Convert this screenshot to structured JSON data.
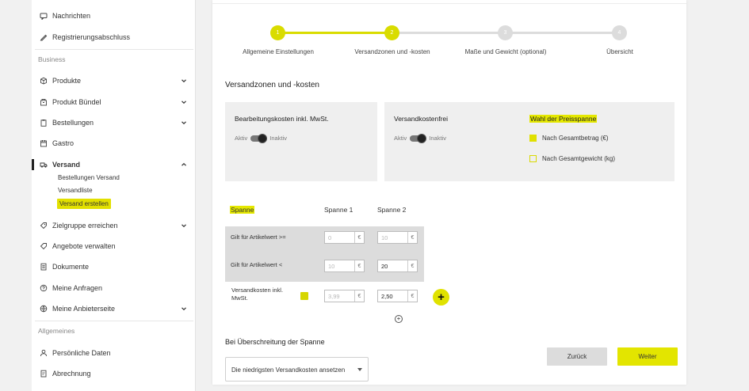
{
  "sidebar": {
    "items_top": [
      {
        "icon": "message-icon",
        "label": "Nachrichten"
      },
      {
        "icon": "pen-icon",
        "label": "Registrierungsabschluss"
      }
    ],
    "section_business": "Business",
    "items_business": [
      {
        "icon": "box-icon",
        "label": "Produkte"
      },
      {
        "icon": "bundle-icon",
        "label": "Produkt Bündel"
      },
      {
        "icon": "clipboard-icon",
        "label": "Bestellungen"
      },
      {
        "icon": "calendar-icon",
        "label": "Gastro"
      },
      {
        "icon": "truck-icon",
        "label": "Versand"
      }
    ],
    "versand_sub": [
      "Bestellungen Versand",
      "Versandliste",
      "Versand erstellen"
    ],
    "items_more": [
      {
        "icon": "tag-icon",
        "label": "Zielgruppe erreichen"
      },
      {
        "icon": "offer-icon",
        "label": "Angebote verwalten"
      },
      {
        "icon": "document-icon",
        "label": "Dokumente"
      },
      {
        "icon": "question-icon",
        "label": "Meine Anfragen"
      },
      {
        "icon": "globe-icon",
        "label": "Meine Anbieterseite"
      }
    ],
    "section_general": "Allgemeines",
    "items_general": [
      {
        "icon": "person-icon",
        "label": "Persönliche Daten"
      },
      {
        "icon": "invoice-icon",
        "label": "Abrechnung"
      }
    ]
  },
  "stepper": {
    "steps": [
      {
        "num": "1",
        "label": "Allgemeine Einstellungen",
        "state": "done"
      },
      {
        "num": "2",
        "label": "Versandzonen und -kosten",
        "state": "done"
      },
      {
        "num": "3",
        "label": "Maße und Gewicht (optional)",
        "state": "todo"
      },
      {
        "num": "4",
        "label": "Übersicht",
        "state": "todo"
      }
    ],
    "accent": "#d9dc00"
  },
  "main": {
    "section_title": "Versandzonen und -kosten",
    "card_processing": {
      "title": "Bearbeitungskosten inkl. MwSt.",
      "active": "Aktiv",
      "inactive": "Inaktiv"
    },
    "card_free": {
      "title": "Versandkostenfrei",
      "active": "Aktiv",
      "inactive": "Inaktiv"
    },
    "price_range": {
      "title": "Wahl der Preisspanne",
      "options": [
        {
          "label": "Nach Gesamtbetrag (€)",
          "selected": true
        },
        {
          "label": "Nach Gesamtgewicht (kg)",
          "selected": false
        }
      ]
    },
    "table": {
      "spanne_label": "Spanne",
      "columns": [
        "Spanne 1",
        "Spanne 2"
      ],
      "rows": [
        {
          "label": "Gilt für Artikelwert >=",
          "values": [
            {
              "value": "0",
              "placeholder": true
            },
            {
              "value": "10",
              "placeholder": true
            }
          ]
        },
        {
          "label": "Gilt für Artikelwert <",
          "values": [
            {
              "value": "10",
              "placeholder": true
            },
            {
              "value": "20",
              "placeholder": false
            }
          ]
        },
        {
          "label": "Versandkosten inkl. MwSt.",
          "values": [
            {
              "value": "3,99",
              "placeholder": true
            },
            {
              "value": "2,50",
              "placeholder": false
            }
          ]
        }
      ],
      "unit": "€",
      "add_symbol": "+"
    },
    "overflow": {
      "title": "Bei Überschreitung der Spanne",
      "selected": "Die niedrigsten Versandkosten ansetzen"
    },
    "buttons": {
      "back": "Zurück",
      "next": "Weiter"
    }
  }
}
